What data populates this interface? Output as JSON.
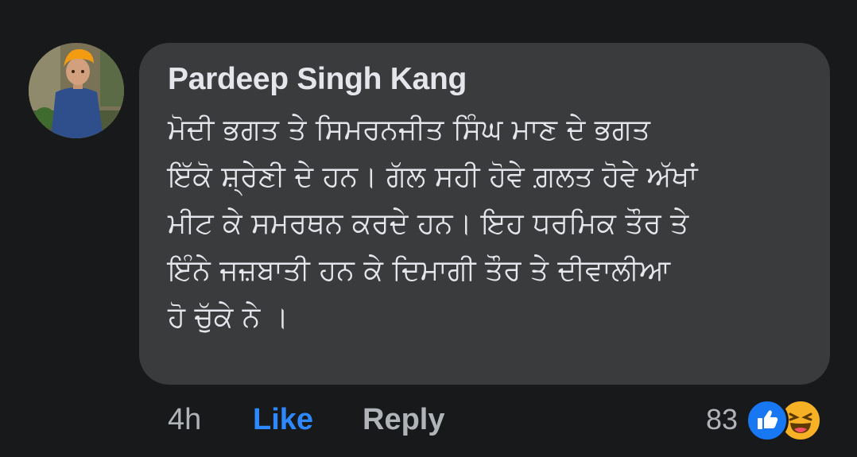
{
  "comment": {
    "author": "Pardeep Singh Kang",
    "text": "ਮੋਦੀ ਭਗਤ ਤੇ ਸਿਮਰਨਜੀਤ ਸਿੰਘ ਮਾਣ ਦੇ ਭਗਤ\nਇੱਕੋ ਸ਼੍ਰੇਣੀ ਦੇ ਹਨ। ਗੱਲ ਸਹੀ ਹੋਵੇ ਗ਼ਲਤ ਹੋਵੇ ਅੱਖਾਂ\nਮੀਟ ਕੇ ਸਮਰਥਨ ਕਰਦੇ ਹਨ।  ਇਹ ਧਰਮਿਕ ਤੌਰ ਤੇ\nਇੰਨੇ ਜਜ਼ਬਾਤੀ ਹਨ ਕੇ ਦਿਮਾਗੀ ਤੌਰ ਤੇ ਦੀਵਾਲੀਆ\nਹੋ ਚੁੱਕੇ ਨੇ ।"
  },
  "actions": {
    "time": "4h",
    "like_label": "Like",
    "reply_label": "Reply"
  },
  "reactions": {
    "count": "83",
    "types": [
      "like-icon",
      "haha-icon"
    ]
  },
  "colors": {
    "background": "#18191a",
    "bubble": "#3a3b3c",
    "text": "#e4e6eb",
    "secondary_text": "#b0b3b8",
    "like_blue": "#2e89ff",
    "reaction_like": "#1877f2",
    "reaction_haha": "#f7b125"
  }
}
